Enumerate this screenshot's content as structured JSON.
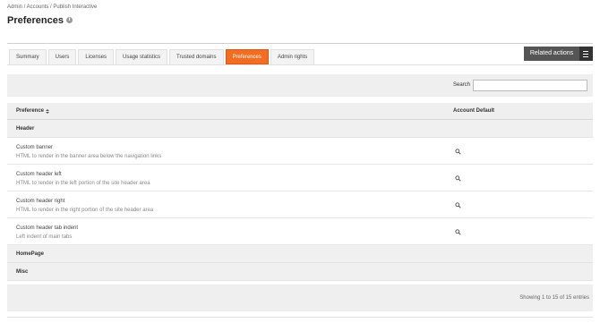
{
  "breadcrumb": "Admin / Accounts / Publish Interactive",
  "page_title": "Preferences",
  "tabs": [
    {
      "label": "Summary"
    },
    {
      "label": "Users"
    },
    {
      "label": "Licenses"
    },
    {
      "label": "Usage statistics"
    },
    {
      "label": "Trusted domains"
    },
    {
      "label": "Preferences",
      "active": true
    },
    {
      "label": "Admin rights"
    }
  ],
  "related_actions": {
    "label": "Related actions",
    "icon": "menu-icon"
  },
  "search": {
    "label": "Search",
    "value": ""
  },
  "table": {
    "columns": {
      "preference": "Preference",
      "account_default": "Account Default"
    },
    "groups": [
      {
        "label": "Header",
        "rows": [
          {
            "name": "Custom banner",
            "description": "HTML to render in the banner area below the navigation links",
            "icon": "magnifier-icon"
          },
          {
            "name": "Custom header left",
            "description": "HTML to render in the left portion of the site header area",
            "icon": "magnifier-icon"
          },
          {
            "name": "Custom header right",
            "description": "HTML to render in the right portion of the site header area",
            "icon": "magnifier-icon"
          },
          {
            "name": "Custom header tab indent",
            "description": "Left indent of main tabs",
            "icon": "magnifier-icon"
          }
        ]
      },
      {
        "label": "HomePage",
        "rows": []
      },
      {
        "label": "Misc",
        "rows": []
      }
    ],
    "footer": "Showing 1 to 15 of 15 entries"
  },
  "colors": {
    "accent": "#f46b22",
    "related_actions_bg": "#555555",
    "header_bg": "#efefef"
  }
}
